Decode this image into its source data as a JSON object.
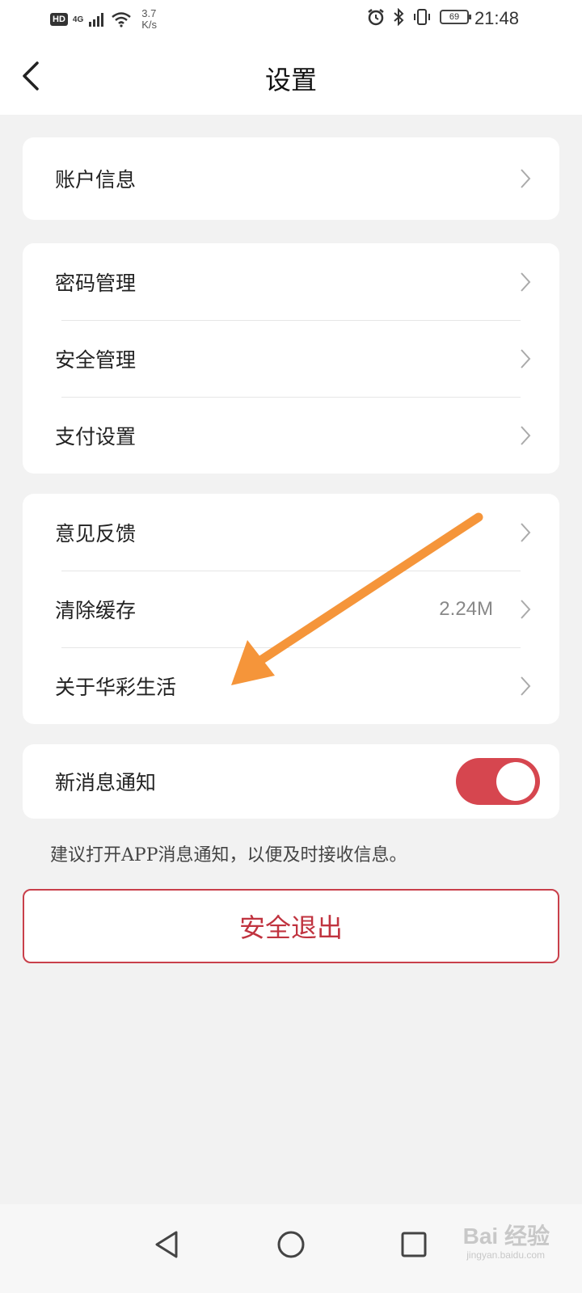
{
  "status_bar": {
    "hd": "HD",
    "network": "4G",
    "net_speed_value": "3.7",
    "net_speed_unit": "K/s",
    "battery": "69",
    "time": "21:48"
  },
  "header": {
    "title": "设置"
  },
  "groups": {
    "account": {
      "account_info": "账户信息"
    },
    "security": {
      "password": "密码管理",
      "safety": "安全管理",
      "payment": "支付设置"
    },
    "misc": {
      "feedback": "意见反馈",
      "clear_cache": "清除缓存",
      "cache_size": "2.24M",
      "about": "关于华彩生活"
    },
    "notify": {
      "label": "新消息通知",
      "enabled": true
    }
  },
  "hint": "建议打开APP消息通知，以便及时接收信息。",
  "logout_label": "安全退出",
  "watermark": {
    "text": "Bai 经验",
    "sub": "jingyan.baidu.com"
  },
  "colors": {
    "accent": "#c0333f",
    "toggle_on": "#d6464f",
    "annotation_arrow": "#f5953a"
  }
}
